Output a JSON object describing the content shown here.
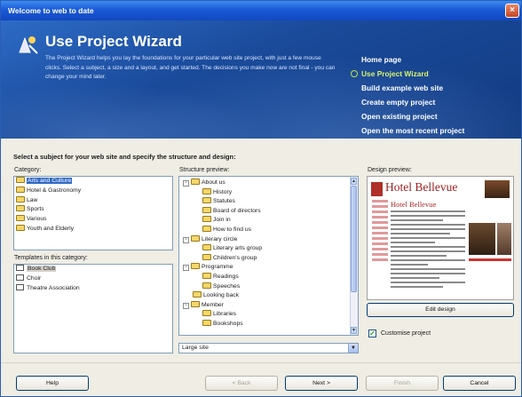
{
  "window": {
    "title": "Welcome to web to date",
    "close_label": "×"
  },
  "banner": {
    "title": "Use Project Wizard",
    "description": "The Project Wizard helps you lay the foundations for your particular web site project, with just a few mouse clicks. Select a subject, a size and a layout, and get started. The decisions you make now are not final - you can change your mind later."
  },
  "nav": {
    "items": [
      {
        "label": "Home page",
        "active": false
      },
      {
        "label": "Use Project Wizard",
        "active": true
      },
      {
        "label": "Build example web site",
        "active": false
      },
      {
        "label": "Create empty project",
        "active": false
      },
      {
        "label": "Open existing project",
        "active": false
      },
      {
        "label": "Open the most recent project",
        "active": false
      }
    ]
  },
  "content": {
    "instruction": "Select a subject for your web site and specify the structure and design:",
    "category_label": "Category:",
    "categories": [
      "Arts and Culture",
      "Hotel & Gastronomy",
      "Law",
      "Sports",
      "Various",
      "Youth and Elderly"
    ],
    "templates_label": "Templates in this category:",
    "templates": [
      "Book Club",
      "Choir",
      "Theatre Association"
    ],
    "structure_label": "Structure preview:",
    "structure": [
      {
        "label": "About us",
        "level": 0,
        "expander": "−"
      },
      {
        "label": "History",
        "level": 1
      },
      {
        "label": "Statutes",
        "level": 1
      },
      {
        "label": "Board of directors",
        "level": 1
      },
      {
        "label": "Join in",
        "level": 1
      },
      {
        "label": "How to find us",
        "level": 1
      },
      {
        "label": "Literary circle",
        "level": 0,
        "expander": "−"
      },
      {
        "label": "Literary arts group",
        "level": 1
      },
      {
        "label": "Children's group",
        "level": 1
      },
      {
        "label": "Programme",
        "level": 0,
        "expander": "−"
      },
      {
        "label": "Readings",
        "level": 1
      },
      {
        "label": "Speeches",
        "level": 1
      },
      {
        "label": "Looking back",
        "level": 0
      },
      {
        "label": "Member",
        "level": 0,
        "expander": "−"
      },
      {
        "label": "Libraries",
        "level": 1
      },
      {
        "label": "Bookshops",
        "level": 1
      }
    ],
    "size_select": "Large site",
    "design_label": "Design preview:",
    "preview": {
      "heading": "Hotel Bellevue",
      "subheading": "Hotel Bellevue"
    },
    "edit_design_label": "Edit design",
    "customise_label": "Customise project",
    "customise_checked": true
  },
  "buttons": {
    "help": "Help",
    "back": "< Back",
    "next": "Next >",
    "finish": "Finish",
    "cancel": "Cancel"
  },
  "colors": {
    "accent": "#316ac5",
    "nav_active": "#d6f26a",
    "banner": "#1a4a9a"
  }
}
